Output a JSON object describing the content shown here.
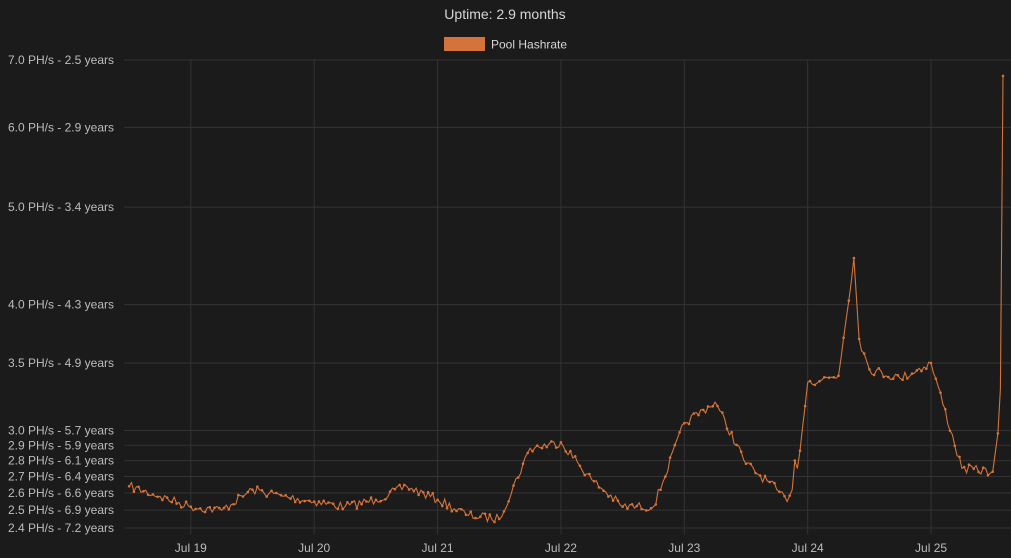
{
  "chart_data": {
    "type": "line",
    "title": "Uptime: 2.9 months",
    "y_scale": "log",
    "ylim": [
      2.4,
      7.0
    ],
    "y_ticks": [
      {
        "value": 7.0,
        "label": "7.0 PH/s - 2.5 years"
      },
      {
        "value": 6.0,
        "label": "6.0 PH/s - 2.9 years"
      },
      {
        "value": 5.0,
        "label": "5.0 PH/s - 3.4 years"
      },
      {
        "value": 4.0,
        "label": "4.0 PH/s - 4.3 years"
      },
      {
        "value": 3.5,
        "label": "3.5 PH/s - 4.9 years"
      },
      {
        "value": 3.0,
        "label": "3.0 PH/s - 5.7 years"
      },
      {
        "value": 2.9,
        "label": "2.9 PH/s - 5.9 years"
      },
      {
        "value": 2.8,
        "label": "2.8 PH/s - 6.1 years"
      },
      {
        "value": 2.7,
        "label": "2.7 PH/s - 6.4 years"
      },
      {
        "value": 2.6,
        "label": "2.6 PH/s - 6.6 years"
      },
      {
        "value": 2.5,
        "label": "2.5 PH/s - 6.9 years"
      },
      {
        "value": 2.4,
        "label": "2.4 PH/s - 7.2 years"
      }
    ],
    "xlim": [
      "Jul 18 11:00",
      "Jul 25 14:00"
    ],
    "x_ticks": [
      "Jul 19",
      "Jul 20",
      "Jul 21",
      "Jul 22",
      "Jul 23",
      "Jul 24",
      "Jul 25"
    ],
    "grid": true,
    "legend_position": "top",
    "series": [
      {
        "name": "Pool Hashrate",
        "color": "#d4733a",
        "x": [
          "Jul 18 12:00",
          "Jul 18 18:00",
          "Jul 19 00:00",
          "Jul 19 06:00",
          "Jul 19 12:00",
          "Jul 19 18:00",
          "Jul 20 00:00",
          "Jul 20 06:00",
          "Jul 20 12:00",
          "Jul 20 18:00",
          "Jul 21 00:00",
          "Jul 21 06:00",
          "Jul 21 12:00",
          "Jul 21 18:00",
          "Jul 22 00:00",
          "Jul 22 06:00",
          "Jul 22 12:00",
          "Jul 22 18:00",
          "Jul 23 00:00",
          "Jul 23 06:00",
          "Jul 23 12:00",
          "Jul 23 18:00",
          "Jul 23 20:00",
          "Jul 23 21:00",
          "Jul 23 21:30",
          "Jul 23 22:00",
          "Jul 24 00:00",
          "Jul 24 06:00",
          "Jul 24 09:00",
          "Jul 24 10:00",
          "Jul 24 12:00",
          "Jul 24 18:00",
          "Jul 25 00:00",
          "Jul 25 06:00",
          "Jul 25 12:00",
          "Jul 25 13:00",
          "Jul 25 13:30",
          "Jul 25 14:00"
        ],
        "values": [
          2.64,
          2.58,
          2.52,
          2.5,
          2.62,
          2.58,
          2.55,
          2.52,
          2.56,
          2.64,
          2.56,
          2.47,
          2.45,
          2.88,
          2.92,
          2.68,
          2.52,
          2.52,
          3.05,
          3.2,
          2.78,
          2.62,
          2.55,
          2.62,
          2.8,
          2.75,
          3.35,
          3.4,
          4.45,
          3.7,
          3.45,
          3.38,
          3.5,
          2.75,
          2.73,
          2.98,
          3.3,
          6.75
        ]
      }
    ]
  }
}
